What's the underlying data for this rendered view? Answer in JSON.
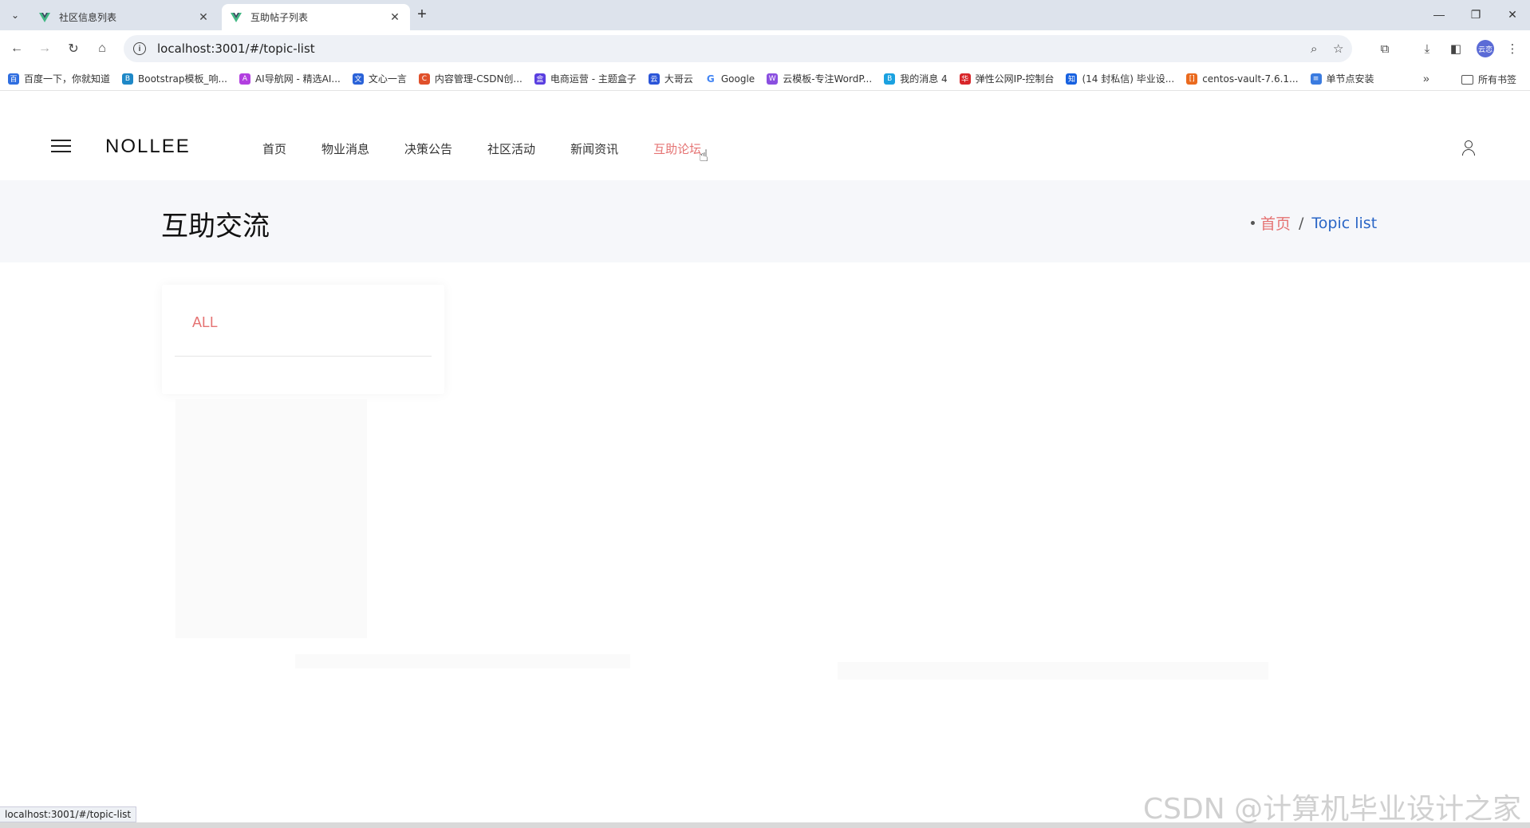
{
  "browser": {
    "tabs": [
      {
        "title": "社区信息列表",
        "active": false
      },
      {
        "title": "互助帖子列表",
        "active": true
      }
    ],
    "new_tab": "+",
    "url": "localhost:3001/#/topic-list",
    "profile_label": "云恋",
    "bookmarks": [
      {
        "label": "百度一下，你就知道",
        "color": "#2f6ee0"
      },
      {
        "label": "Bootstrap模板_响...",
        "color": "#1e88c7"
      },
      {
        "label": "AI导航网 - 精选AI...",
        "color": "#b23fe0"
      },
      {
        "label": "文心一言",
        "color": "#2a62d8"
      },
      {
        "label": "内容管理-CSDN创...",
        "color": "#e0502b"
      },
      {
        "label": "电商运营 - 主题盒子",
        "color": "#5a3fe0"
      },
      {
        "label": "大哥云",
        "color": "#2b55d8"
      },
      {
        "label": "Google",
        "color": "#4285f4"
      },
      {
        "label": "云模板-专注WordP...",
        "color": "#8a4fe0"
      },
      {
        "label": "我的消息 4",
        "color": "#1aa1e0"
      },
      {
        "label": "弹性公网IP-控制台",
        "color": "#d8262a"
      },
      {
        "label": "(14 封私信) 毕业设...",
        "color": "#1761e0"
      },
      {
        "label": "centos-vault-7.6.1...",
        "color": "#ea6a1e"
      },
      {
        "label": "单节点安装",
        "color": "#3a7be0"
      }
    ],
    "bookmarks_more": "»",
    "all_bookmarks": "所有书签",
    "status_url": "localhost:3001/#/topic-list"
  },
  "site": {
    "logo": "NOLLEE",
    "nav": [
      "首页",
      "物业消息",
      "决策公告",
      "社区活动",
      "新闻资讯",
      "互助论坛"
    ],
    "active_nav_index": 5,
    "accent_color": "#e57373",
    "link_color": "#2a66c6"
  },
  "banner": {
    "title": "互助交流",
    "breadcrumb_home": "首页",
    "breadcrumb_sep": "/",
    "breadcrumb_current": "Topic list"
  },
  "filter": {
    "all_label": "ALL"
  },
  "watermark": "CSDN @计算机毕业设计之家"
}
